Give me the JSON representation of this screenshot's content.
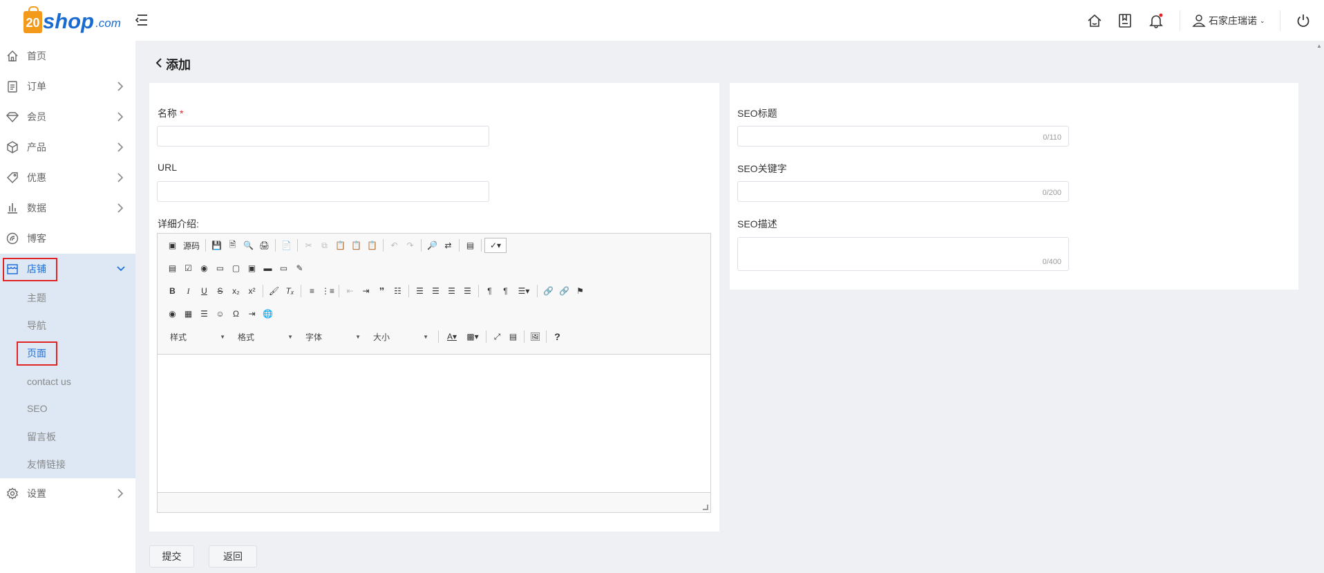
{
  "header": {
    "logo": {
      "badge": "20",
      "shop": "shop",
      "com": ".com"
    },
    "icons": [
      "home-icon",
      "bookmark-icon",
      "bell-icon",
      "user-icon",
      "power-icon"
    ],
    "user_name": "石家庄瑞诺",
    "notification_dot_color": "#e02424"
  },
  "sidebar": {
    "items": [
      {
        "label": "首页",
        "icon": "home-icon",
        "has_arrow": false
      },
      {
        "label": "订单",
        "icon": "clipboard-icon",
        "has_arrow": true
      },
      {
        "label": "会员",
        "icon": "diamond-icon",
        "has_arrow": true
      },
      {
        "label": "产品",
        "icon": "box-icon",
        "has_arrow": true
      },
      {
        "label": "优惠",
        "icon": "tag-icon",
        "has_arrow": true
      },
      {
        "label": "数据",
        "icon": "bar-chart-icon",
        "has_arrow": true
      },
      {
        "label": "博客",
        "icon": "blog-icon",
        "has_arrow": false
      },
      {
        "label": "店铺",
        "icon": "store-icon",
        "has_arrow": true,
        "expanded": true
      },
      {
        "label": "设置",
        "icon": "settings-icon",
        "has_arrow": true
      }
    ],
    "store_submenu": [
      "主题",
      "导航",
      "页面",
      "contact us",
      "SEO",
      "留言板",
      "友情链接"
    ],
    "active_sub": "页面",
    "accent_color": "#1e6fd9"
  },
  "page": {
    "title": "添加",
    "name_label": "名称",
    "required_mark": "*",
    "url_label": "URL",
    "detail_label": "详细介绍:",
    "seo_title_label": "SEO标题",
    "seo_title_counter": "0/110",
    "seo_keywords_label": "SEO关键字",
    "seo_keywords_counter": "0/200",
    "seo_desc_label": "SEO描述",
    "seo_desc_counter": "0/400",
    "submit_label": "提交",
    "back_label": "返回"
  },
  "editor": {
    "source_label": "源码",
    "combos": [
      "样式",
      "格式",
      "字体",
      "大小"
    ]
  }
}
